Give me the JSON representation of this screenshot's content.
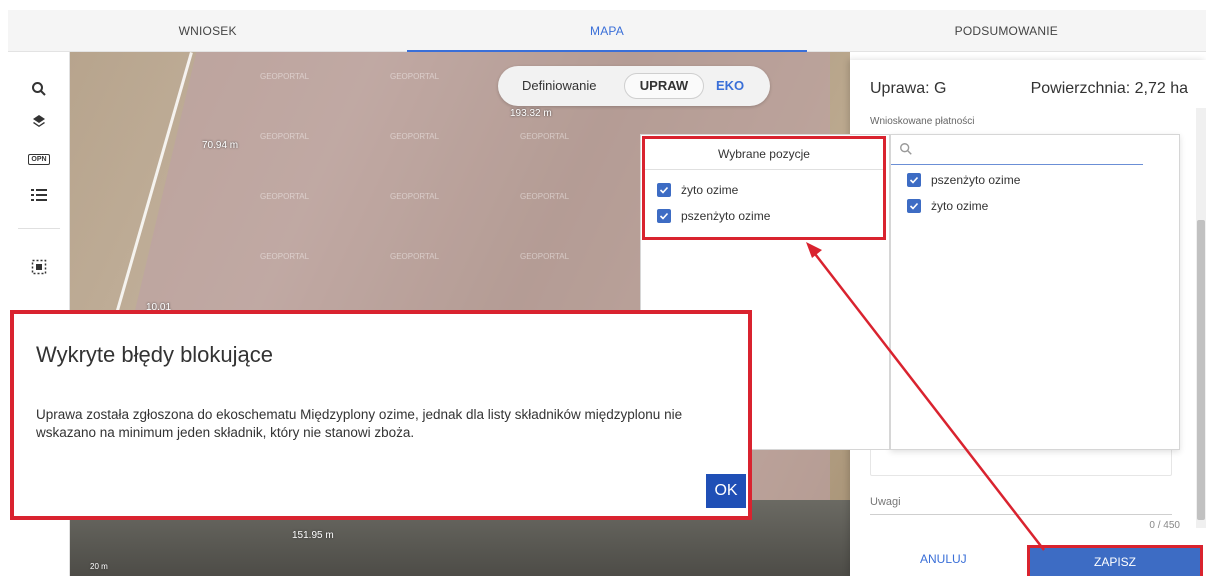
{
  "tabs": [
    {
      "label": "WNIOSEK"
    },
    {
      "label": "MAPA"
    },
    {
      "label": "PODSUMOWANIE"
    }
  ],
  "toolbar": {
    "icons": [
      "search-icon",
      "layers-icon",
      "opn-icon",
      "list-icon",
      "select-area-icon"
    ],
    "opn_label": "OPN"
  },
  "map": {
    "measure_top": "193.32 m",
    "measure_left": "70.94 m",
    "measure_left2": "10.01",
    "measure_bottom": "151.95 m",
    "scale": "20 m",
    "watermark": "GEOPORTAL"
  },
  "mode_switch": {
    "label": "Definiowanie",
    "option_1": "UPRAW",
    "option_2": "EKO"
  },
  "panel": {
    "crop_title": "Uprawa: G",
    "area_title": "Powierzchnia: 2,72 ha",
    "payments_label": "Wnioskowane płatności",
    "notes_label": "Uwagi",
    "char_count": "0 / 450",
    "cancel_label": "ANULUJ",
    "save_label": "ZAPISZ"
  },
  "dropdown": {
    "search_placeholder": "",
    "items": [
      {
        "label": "pszenżyto ozime",
        "checked": true
      },
      {
        "label": "żyto ozime",
        "checked": true
      }
    ]
  },
  "selected_popover": {
    "title": "Wybrane pozycje",
    "items": [
      {
        "label": "żyto ozime",
        "checked": true
      },
      {
        "label": "pszenżyto ozime",
        "checked": true
      }
    ]
  },
  "dialog": {
    "title": "Wykryte błędy blokujące",
    "message": "Uprawa została zgłoszona do ekoschematu Międzyplony ozime, jednak dla listy składników międzyplonu nie wskazano na minimum jeden składnik, który nie stanowi zboża.",
    "ok_label": "OK"
  },
  "colors": {
    "accent": "#3a6fd8",
    "highlight": "#d9232f",
    "ok_button": "#1f4fb6"
  }
}
